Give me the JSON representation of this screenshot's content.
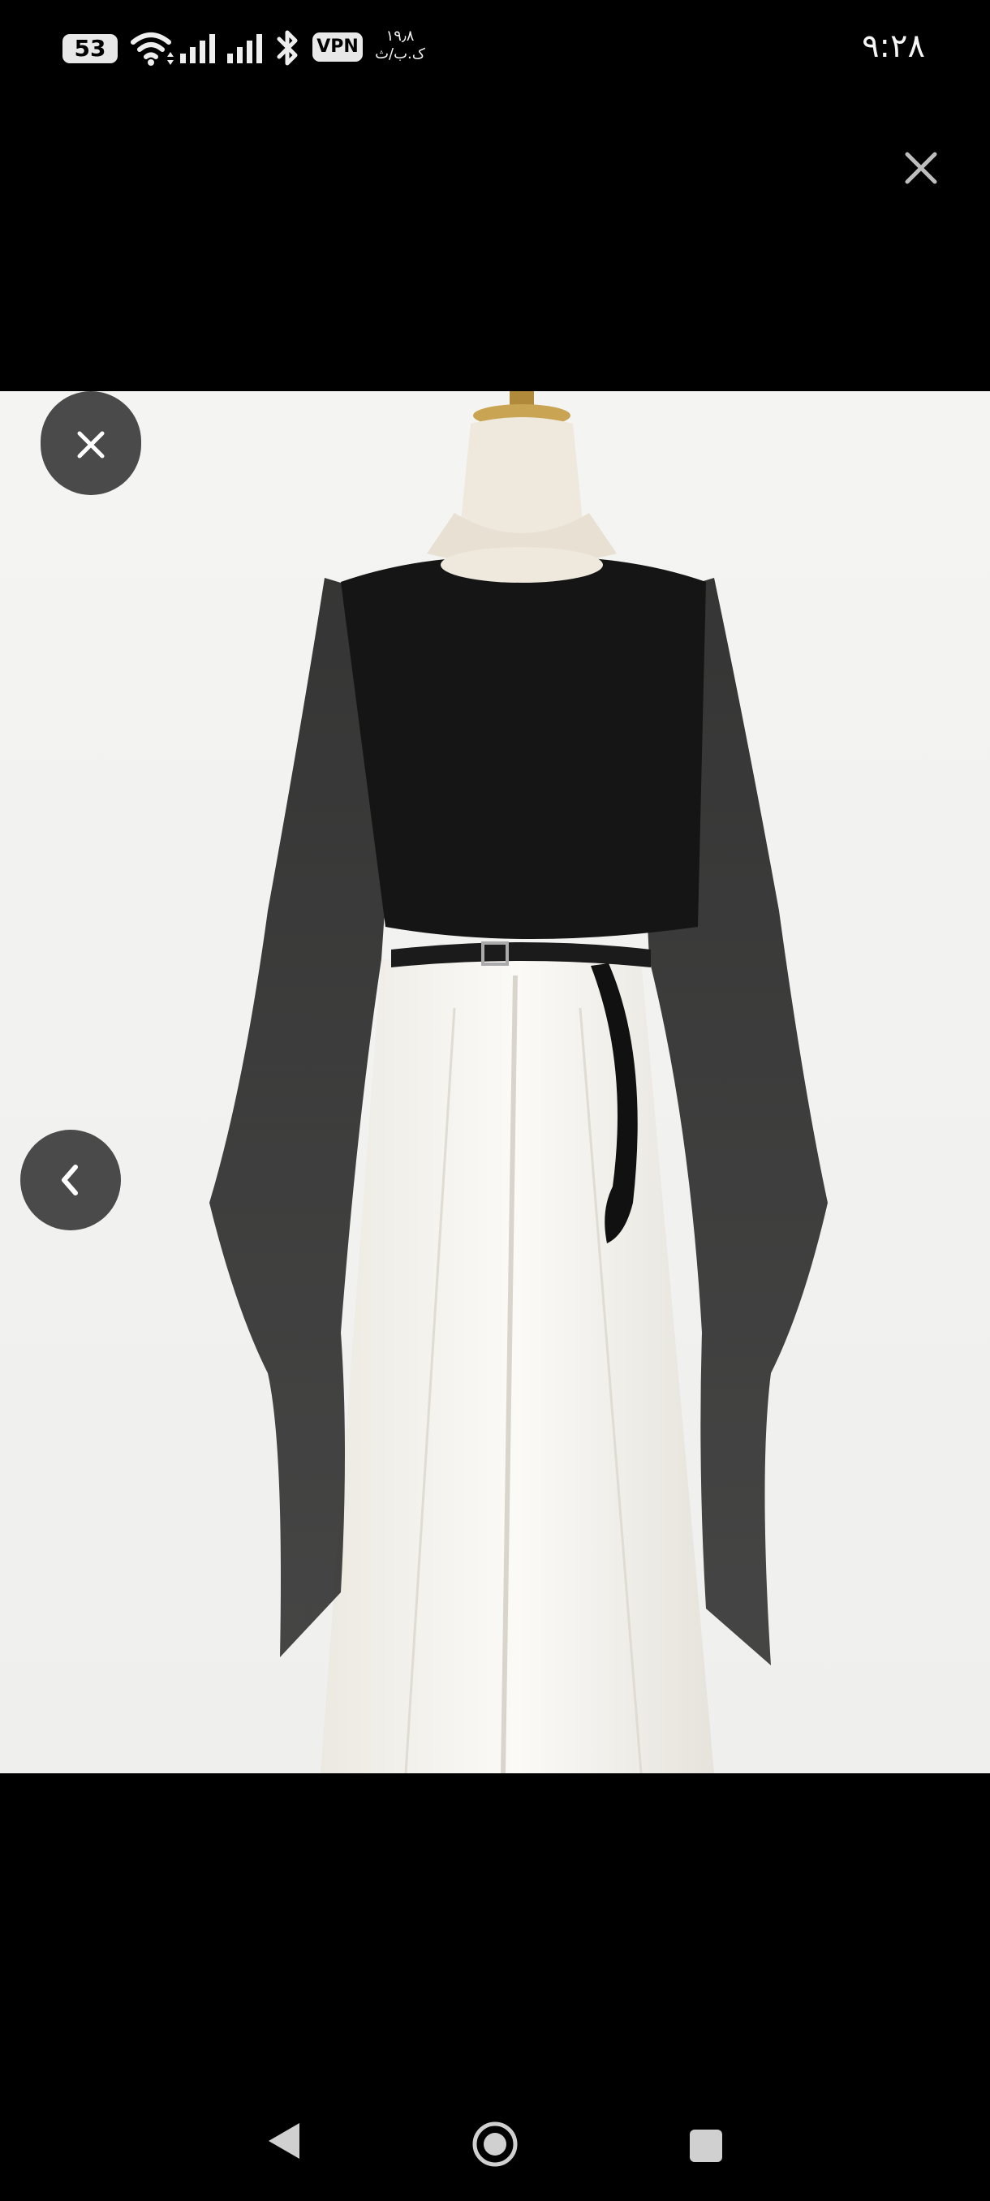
{
  "status_bar": {
    "battery": "53",
    "vpn": "VPN",
    "speed_value": "١٩٫٨",
    "speed_unit": "ک.ب/ث",
    "time": "٩:٢٨"
  },
  "icons": {
    "top_close": "close-icon",
    "viewer_close": "close-icon",
    "prev": "chevron-left-icon",
    "nav_back": "back-triangle-icon",
    "nav_home": "home-circle-icon",
    "nav_recents": "recents-square-icon"
  },
  "colors": {
    "background": "#000000",
    "viewer_background": "#f2f2f1",
    "overlay_button": "#4a4a4a"
  }
}
